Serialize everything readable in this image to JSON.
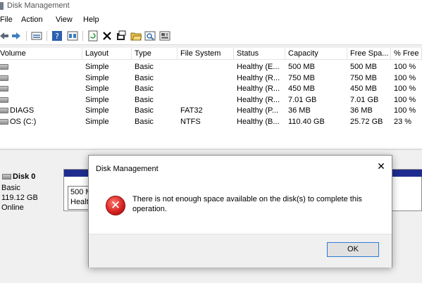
{
  "window": {
    "title": "Disk Management"
  },
  "menu": [
    "File",
    "Action",
    "View",
    "Help"
  ],
  "toolbar_icons": [
    "back-icon",
    "forward-icon",
    "disk-list-icon",
    "help-icon",
    "properties-icon",
    "refresh-icon",
    "delete-icon",
    "settings-icon",
    "open-folder-icon",
    "find-icon",
    "disk-props-icon"
  ],
  "volumes": {
    "columns": [
      "Volume",
      "Layout",
      "Type",
      "File System",
      "Status",
      "Capacity",
      "Free Spa...",
      "% Free"
    ],
    "rows": [
      [
        "",
        "Simple",
        "Basic",
        "",
        "Healthy (E...",
        "500 MB",
        "500 MB",
        "100 %"
      ],
      [
        "",
        "Simple",
        "Basic",
        "",
        "Healthy (R...",
        "750 MB",
        "750 MB",
        "100 %"
      ],
      [
        "",
        "Simple",
        "Basic",
        "",
        "Healthy (R...",
        "450 MB",
        "450 MB",
        "100 %"
      ],
      [
        "",
        "Simple",
        "Basic",
        "",
        "Healthy (R...",
        "7.01 GB",
        "7.01 GB",
        "100 %"
      ],
      [
        "DIAGS",
        "Simple",
        "Basic",
        "FAT32",
        "Healthy (P...",
        "36 MB",
        "36 MB",
        "100 %"
      ],
      [
        "OS (C:)",
        "Simple",
        "Basic",
        "NTFS",
        "Healthy (B...",
        "110.40 GB",
        "25.72 GB",
        "23 %"
      ]
    ]
  },
  "disk": {
    "name": "Disk 0",
    "type": "Basic",
    "size": "119.12 GB",
    "status": "Online",
    "partition_size": "500 M",
    "partition_status": "Healt"
  },
  "dialog": {
    "title": "Disk Management",
    "message": "There is not enough space available on the disk(s) to complete this operation.",
    "ok_label": "OK",
    "close_glyph": "✕"
  },
  "colors": {
    "disk_bar": "#1f2c8f",
    "error_red": "#d21f1f",
    "ok_border": "#2b7cd3"
  }
}
